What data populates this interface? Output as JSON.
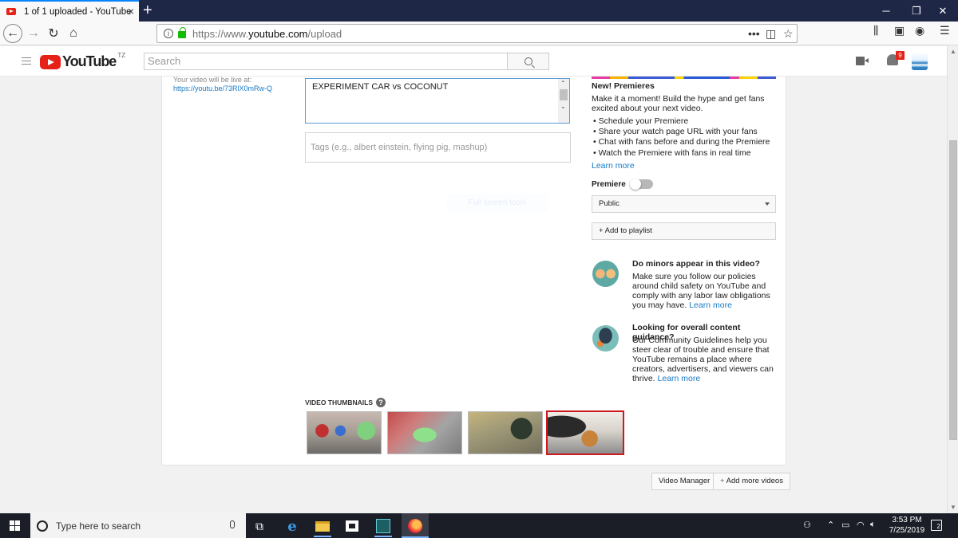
{
  "browser": {
    "tab_title": "1 of 1 uploaded - YouTube",
    "url_prefix": "https://www.",
    "url_domain": "youtube.com",
    "url_path": "/upload"
  },
  "youtube": {
    "logo_text": "YouTube",
    "country": "TZ",
    "search_placeholder": "Search",
    "notification_count": "9"
  },
  "upload": {
    "live_label": "Your video will be live at:",
    "live_link": "https://youtu.be/73RlX0mRw-Q",
    "title_value": "EXPERIMENT CAR vs COCONUT",
    "tags_placeholder": "Tags (e.g., albert einstein, flying pig, mashup)",
    "ghost_button": "Full screen tools",
    "thumbnails_label": "VIDEO THUMBNAILS",
    "thumbnails_help": "?",
    "selected_thumbnail": 4
  },
  "sidebar": {
    "premieres_heading": "New! Premieres",
    "premieres_text_1": "Make it a moment! Build the hype and get fans",
    "premieres_text_2": "excited about your next video.",
    "bullets": [
      "• Schedule your Premiere",
      "• Share your watch page URL with your fans",
      "• Chat with fans before and during the Premiere",
      "• Watch the Premiere with fans in real time"
    ],
    "learn_more": "Learn more",
    "premiere_label": "Premiere",
    "premiere_enabled": false,
    "privacy_value": "Public",
    "add_playlist": "+ Add to playlist",
    "minors_heading": "Do minors appear in this video?",
    "minors_text": "Make sure you follow our policies around child safety on YouTube and comply with any labor law obligations you may have.",
    "minors_link": "Learn more",
    "guidance_heading": "Looking for overall content guidance?",
    "guidance_text": "Our Community Guidelines help you steer clear of trouble and ensure that YouTube remains a place where creators, advertisers, and viewers can thrive.",
    "guidance_link": "Learn more"
  },
  "footer": {
    "video_manager": "Video Manager",
    "add_more": "Add more videos"
  },
  "taskbar": {
    "search_placeholder": "Type here to search",
    "time": "3:53 PM",
    "date": "7/25/2019",
    "notifications": "2"
  }
}
